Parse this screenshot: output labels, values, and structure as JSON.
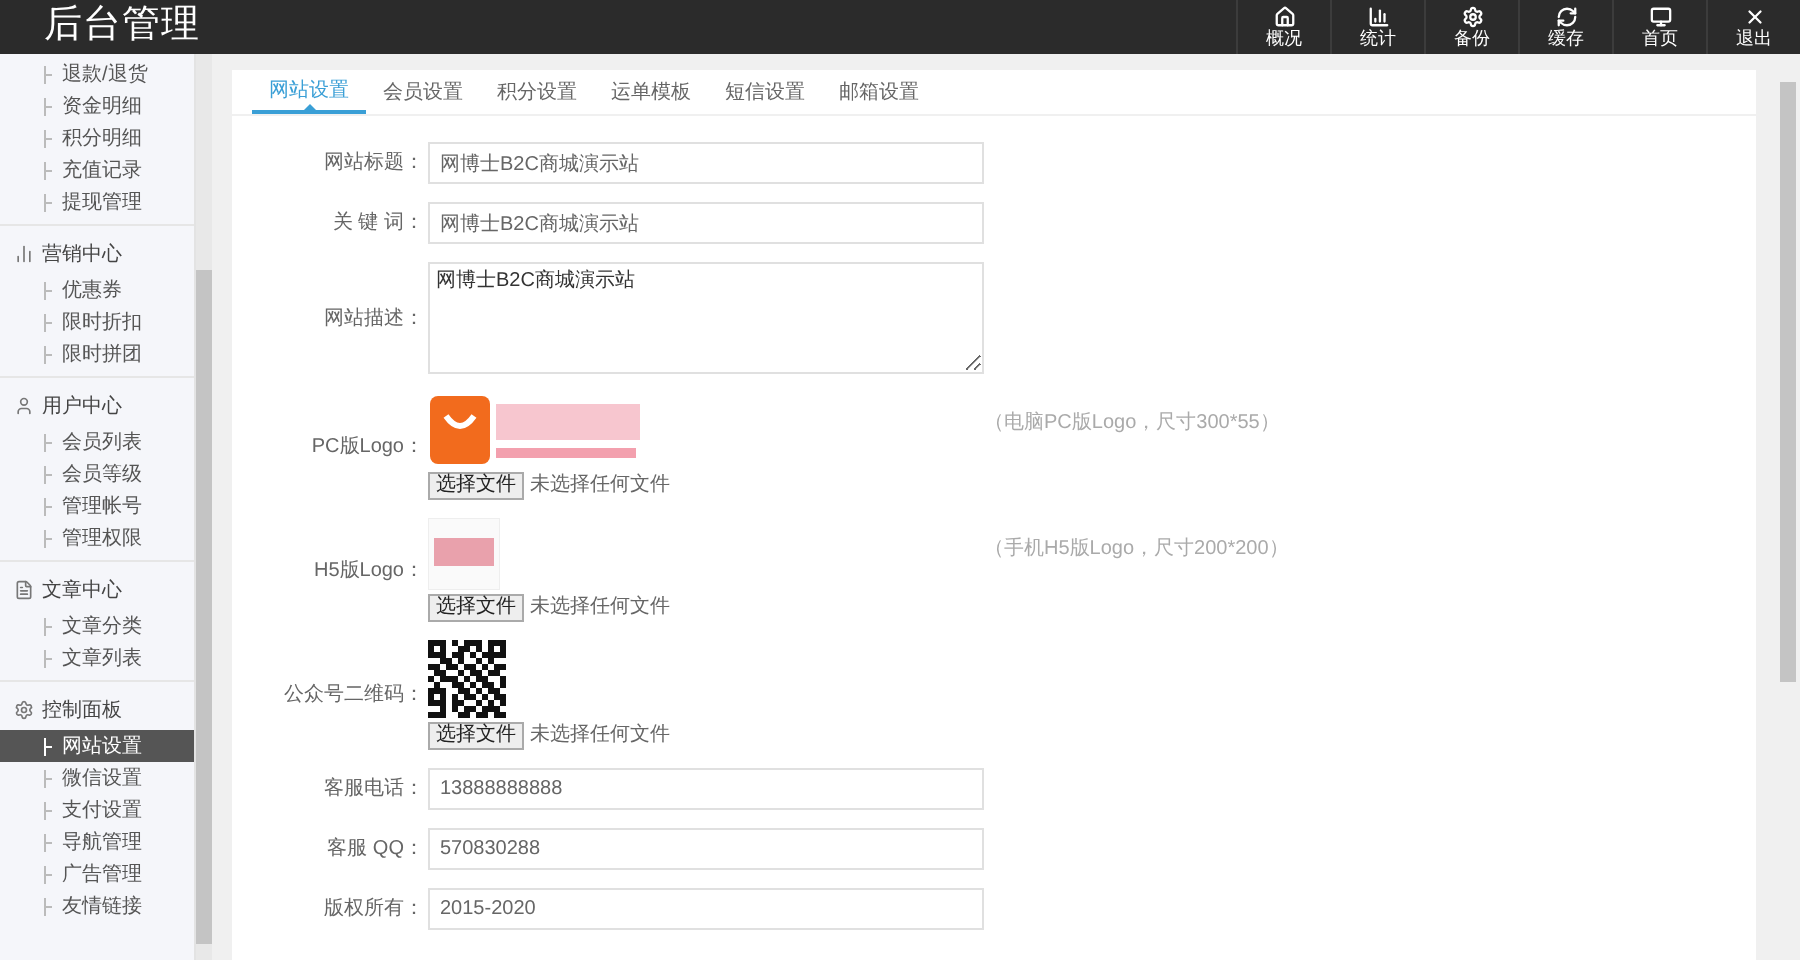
{
  "header": {
    "title": "后台管理",
    "nav": [
      {
        "label": "概况"
      },
      {
        "label": "统计"
      },
      {
        "label": "备份"
      },
      {
        "label": "缓存"
      },
      {
        "label": "首页"
      },
      {
        "label": "退出"
      }
    ]
  },
  "sidebar": {
    "sections": [
      {
        "items": [
          {
            "label": "退款/退货",
            "selected": false
          },
          {
            "label": "资金明细",
            "selected": false
          },
          {
            "label": "积分明细",
            "selected": false
          },
          {
            "label": "充值记录",
            "selected": false
          },
          {
            "label": "提现管理",
            "selected": false
          }
        ]
      },
      {
        "title": "营销中心",
        "items": [
          {
            "label": "优惠券",
            "selected": false
          },
          {
            "label": "限时折扣",
            "selected": false
          },
          {
            "label": "限时拼团",
            "selected": false
          }
        ]
      },
      {
        "title": "用户中心",
        "items": [
          {
            "label": "会员列表",
            "selected": false
          },
          {
            "label": "会员等级",
            "selected": false
          },
          {
            "label": "管理帐号",
            "selected": false
          },
          {
            "label": "管理权限",
            "selected": false
          }
        ]
      },
      {
        "title": "文章中心",
        "items": [
          {
            "label": "文章分类",
            "selected": false
          },
          {
            "label": "文章列表",
            "selected": false
          }
        ]
      },
      {
        "title": "控制面板",
        "items": [
          {
            "label": "网站设置",
            "selected": true
          },
          {
            "label": "微信设置",
            "selected": false
          },
          {
            "label": "支付设置",
            "selected": false
          },
          {
            "label": "导航管理",
            "selected": false
          },
          {
            "label": "广告管理",
            "selected": false
          },
          {
            "label": "友情链接",
            "selected": false
          }
        ]
      }
    ]
  },
  "tabs": [
    {
      "label": "网站设置",
      "selected": true
    },
    {
      "label": "会员设置",
      "selected": false
    },
    {
      "label": "积分设置",
      "selected": false
    },
    {
      "label": "运单模板",
      "selected": false
    },
    {
      "label": "短信设置",
      "selected": false
    },
    {
      "label": "邮箱设置",
      "selected": false
    }
  ],
  "form": [
    {
      "kind": "input",
      "label": "网站标题：",
      "value": "网博士B2C商城演示站"
    },
    {
      "kind": "input",
      "label": "关 键 词：",
      "value": "网博士B2C商城演示站"
    },
    {
      "kind": "textarea",
      "label": "网站描述：",
      "value": "网博士B2C商城演示站"
    },
    {
      "kind": "upload",
      "label": "PC版Logo：",
      "file_button": "选择文件",
      "file_status": "未选择任何文件",
      "hint": "（电脑PC版Logo，尺寸300*55）"
    },
    {
      "kind": "upload",
      "label": "H5版Logo：",
      "file_button": "选择文件",
      "file_status": "未选择任何文件",
      "hint": "（手机H5版Logo，尺寸200*200）"
    },
    {
      "kind": "upload",
      "label": "公众号二维码：",
      "file_button": "选择文件",
      "file_status": "未选择任何文件"
    },
    {
      "kind": "input",
      "label": "客服电话：",
      "value": "13888888888"
    },
    {
      "kind": "input",
      "label": "客服 QQ：",
      "value": "570830288"
    },
    {
      "kind": "input",
      "label": "版权所有：",
      "value": "2015-2020"
    }
  ]
}
